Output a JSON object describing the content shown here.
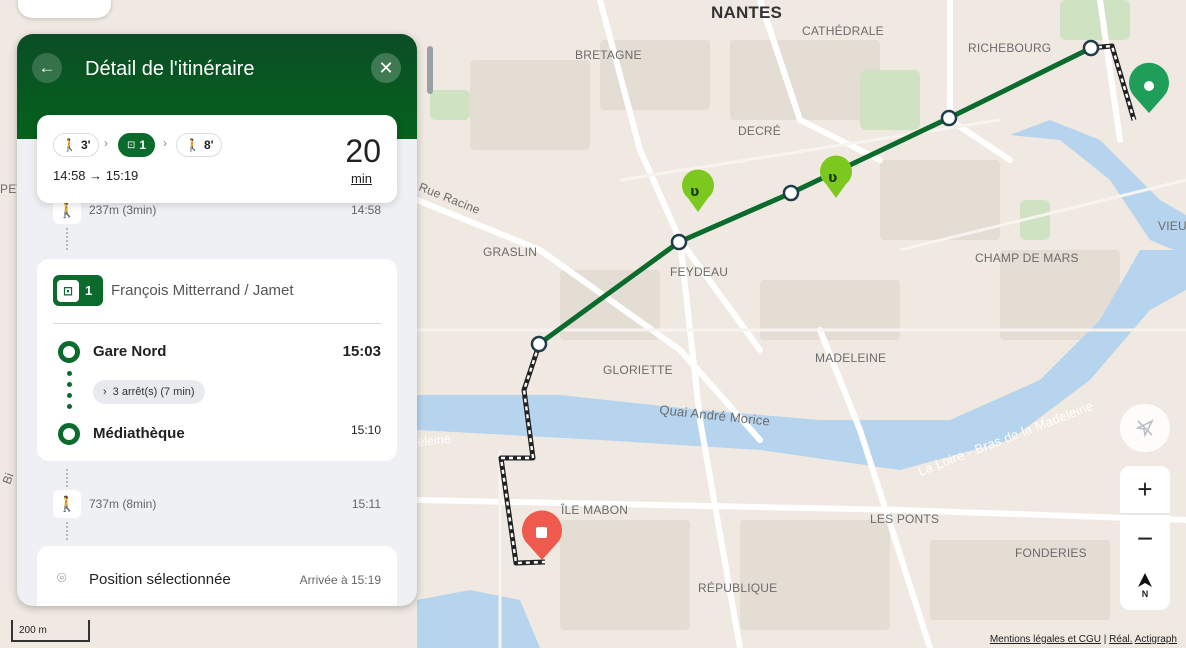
{
  "map": {
    "labels": {
      "nantes": "NANTES",
      "cathedrale": "CATHÉDRALE",
      "bretagne": "BRETAGNE",
      "richebourg": "RICHEBOURG",
      "decre": "DECRÉ",
      "rue_racine": "Rue Racine",
      "graslin": "GRASLIN",
      "feydeau": "FEYDEAU",
      "champ_de_mars": "CHAMP DE MARS",
      "vieux": "VIEU",
      "pet": "PET",
      "madeleine": "MADELEINE",
      "gloriette": "GLORIETTE",
      "quai_andre_morice": "Quai André Morice",
      "loire": "La Loire - Bras de la Madeleine",
      "ile_mabon": "ÎLE MABON",
      "les_ponts": "LES PONTS",
      "fonderies": "FONDERIES",
      "republique": "RÉPUBLIQUE",
      "eleine": "eleine",
      "bi": "Bi"
    },
    "route_color": "#0a6b2c",
    "destination_marker_color": "#ef5a4e",
    "start_marker_color": "#1e9e58",
    "bike_marker_color": "#7cc81e",
    "scale_label": "200 m",
    "attribution": {
      "legal": "Mentions légales et CGU",
      "sep": " | ",
      "real": "Réal.",
      "actigraph": "Actigraph"
    }
  },
  "panel": {
    "title": "Détail de l'itinéraire",
    "back_icon": "arrow-left-icon",
    "close_icon": "close-icon",
    "summary": {
      "walk1": "3'",
      "tram_line": "1",
      "walk2": "8'",
      "times": "14:58 → 15:19",
      "duration": "20",
      "duration_unit": "min"
    },
    "walk_before": {
      "text": "237m (3min)",
      "time": "14:58"
    },
    "leg": {
      "line": "1",
      "direction": "François Mitterrand / Jamet",
      "from_stop": "Gare Nord",
      "from_time": "15:03",
      "stops_info": "3 arrêt(s) (7 min)",
      "to_stop": "Médiathèque",
      "to_time": "15:10"
    },
    "walk_after": {
      "text": "737m (8min)",
      "time": "15:11"
    },
    "destination": {
      "name": "Position sélectionnée",
      "arrival": "Arrivée à 15:19"
    }
  },
  "controls": {
    "zoom_in": "+",
    "zoom_out": "−",
    "north": "N"
  }
}
